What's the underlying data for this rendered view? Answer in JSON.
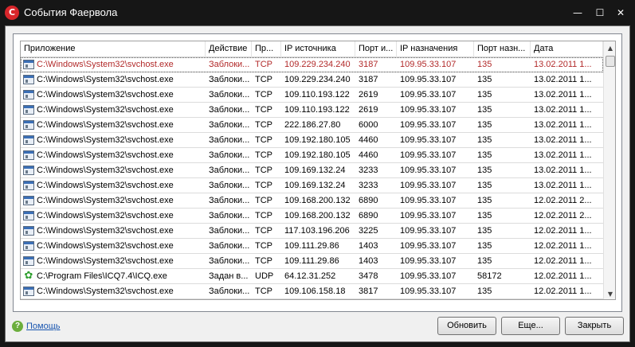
{
  "window": {
    "title": "События Фаервола",
    "app_icon_letter": "C",
    "min_glyph": "—",
    "max_glyph": "☐",
    "close_glyph": "✕"
  },
  "table": {
    "columns": [
      "Приложение",
      "Действие",
      "Пр...",
      "IP источника",
      "Порт и...",
      "IP назначения",
      "Порт назн...",
      "Дата"
    ],
    "rows": [
      {
        "app": "C:\\Windows\\System32\\svchost.exe",
        "action": "Заблоки...",
        "proto": "TCP",
        "src_ip": "109.229.234.240",
        "src_port": "3187",
        "dst_ip": "109.95.33.107",
        "dst_port": "135",
        "date": "13.02.2011 1...",
        "icon": "exe-icon"
      },
      {
        "app": "C:\\Windows\\System32\\svchost.exe",
        "action": "Заблоки...",
        "proto": "TCP",
        "src_ip": "109.229.234.240",
        "src_port": "3187",
        "dst_ip": "109.95.33.107",
        "dst_port": "135",
        "date": "13.02.2011 1...",
        "icon": "exe-icon"
      },
      {
        "app": "C:\\Windows\\System32\\svchost.exe",
        "action": "Заблоки...",
        "proto": "TCP",
        "src_ip": "109.110.193.122",
        "src_port": "2619",
        "dst_ip": "109.95.33.107",
        "dst_port": "135",
        "date": "13.02.2011 1...",
        "icon": "exe-icon"
      },
      {
        "app": "C:\\Windows\\System32\\svchost.exe",
        "action": "Заблоки...",
        "proto": "TCP",
        "src_ip": "109.110.193.122",
        "src_port": "2619",
        "dst_ip": "109.95.33.107",
        "dst_port": "135",
        "date": "13.02.2011 1...",
        "icon": "exe-icon"
      },
      {
        "app": "C:\\Windows\\System32\\svchost.exe",
        "action": "Заблоки...",
        "proto": "TCP",
        "src_ip": "222.186.27.80",
        "src_port": "6000",
        "dst_ip": "109.95.33.107",
        "dst_port": "135",
        "date": "13.02.2011 1...",
        "icon": "exe-icon"
      },
      {
        "app": "C:\\Windows\\System32\\svchost.exe",
        "action": "Заблоки...",
        "proto": "TCP",
        "src_ip": "109.192.180.105",
        "src_port": "4460",
        "dst_ip": "109.95.33.107",
        "dst_port": "135",
        "date": "13.02.2011 1...",
        "icon": "exe-icon"
      },
      {
        "app": "C:\\Windows\\System32\\svchost.exe",
        "action": "Заблоки...",
        "proto": "TCP",
        "src_ip": "109.192.180.105",
        "src_port": "4460",
        "dst_ip": "109.95.33.107",
        "dst_port": "135",
        "date": "13.02.2011 1...",
        "icon": "exe-icon"
      },
      {
        "app": "C:\\Windows\\System32\\svchost.exe",
        "action": "Заблоки...",
        "proto": "TCP",
        "src_ip": "109.169.132.24",
        "src_port": "3233",
        "dst_ip": "109.95.33.107",
        "dst_port": "135",
        "date": "13.02.2011 1...",
        "icon": "exe-icon"
      },
      {
        "app": "C:\\Windows\\System32\\svchost.exe",
        "action": "Заблоки...",
        "proto": "TCP",
        "src_ip": "109.169.132.24",
        "src_port": "3233",
        "dst_ip": "109.95.33.107",
        "dst_port": "135",
        "date": "13.02.2011 1...",
        "icon": "exe-icon"
      },
      {
        "app": "C:\\Windows\\System32\\svchost.exe",
        "action": "Заблоки...",
        "proto": "TCP",
        "src_ip": "109.168.200.132",
        "src_port": "6890",
        "dst_ip": "109.95.33.107",
        "dst_port": "135",
        "date": "12.02.2011 2...",
        "icon": "exe-icon"
      },
      {
        "app": "C:\\Windows\\System32\\svchost.exe",
        "action": "Заблоки...",
        "proto": "TCP",
        "src_ip": "109.168.200.132",
        "src_port": "6890",
        "dst_ip": "109.95.33.107",
        "dst_port": "135",
        "date": "12.02.2011 2...",
        "icon": "exe-icon"
      },
      {
        "app": "C:\\Windows\\System32\\svchost.exe",
        "action": "Заблоки...",
        "proto": "TCP",
        "src_ip": "117.103.196.206",
        "src_port": "3225",
        "dst_ip": "109.95.33.107",
        "dst_port": "135",
        "date": "12.02.2011 1...",
        "icon": "exe-icon"
      },
      {
        "app": "C:\\Windows\\System32\\svchost.exe",
        "action": "Заблоки...",
        "proto": "TCP",
        "src_ip": "109.111.29.86",
        "src_port": "1403",
        "dst_ip": "109.95.33.107",
        "dst_port": "135",
        "date": "12.02.2011 1...",
        "icon": "exe-icon"
      },
      {
        "app": "C:\\Windows\\System32\\svchost.exe",
        "action": "Заблоки...",
        "proto": "TCP",
        "src_ip": "109.111.29.86",
        "src_port": "1403",
        "dst_ip": "109.95.33.107",
        "dst_port": "135",
        "date": "12.02.2011 1...",
        "icon": "exe-icon"
      },
      {
        "app": "C:\\Program Files\\ICQ7.4\\ICQ.exe",
        "action": "Задан в...",
        "proto": "UDP",
        "src_ip": "64.12.31.252",
        "src_port": "3478",
        "dst_ip": "109.95.33.107",
        "dst_port": "58172",
        "date": "12.02.2011 1...",
        "icon": "icq-icon"
      },
      {
        "app": "C:\\Windows\\System32\\svchost.exe",
        "action": "Заблоки...",
        "proto": "TCP",
        "src_ip": "109.106.158.18",
        "src_port": "3817",
        "dst_ip": "109.95.33.107",
        "dst_port": "135",
        "date": "12.02.2011 1...",
        "icon": "exe-icon"
      }
    ],
    "selected_row": 0
  },
  "scrollbar": {
    "up_glyph": "▲",
    "down_glyph": "▼"
  },
  "footer": {
    "help_label": "Помощь",
    "help_glyph": "?",
    "refresh_label": "Обновить",
    "more_label": "Еще...",
    "close_label": "Закрыть"
  },
  "colors": {
    "selected_text": "#b22a2a",
    "accent": "#d8262b",
    "link": "#1a56b0"
  }
}
